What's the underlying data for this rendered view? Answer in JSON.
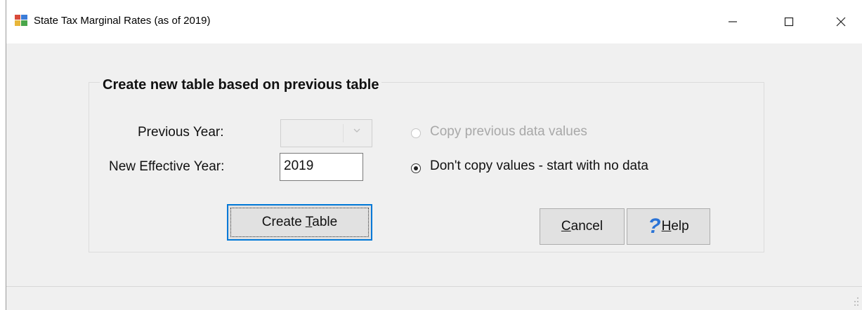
{
  "window": {
    "title": "State Tax Marginal Rates (as of 2019)",
    "icons": {
      "app": "app-icon",
      "minimize": "minimize-icon",
      "maximize": "maximize-icon",
      "close": "close-icon"
    }
  },
  "group": {
    "title": "Create new table based on previous table",
    "previous_year_label": "Previous Year:",
    "previous_year_value": "",
    "new_year_label": "New Effective Year:",
    "new_year_value": "2019",
    "options": [
      {
        "label": "Copy previous data values",
        "selected": false,
        "enabled": false
      },
      {
        "label": "Don't copy values - start with no data",
        "selected": true,
        "enabled": true
      }
    ]
  },
  "buttons": {
    "create_pre": "Create ",
    "create_mnemonic": "T",
    "create_post": "able",
    "cancel_mnemonic": "C",
    "cancel_post": "ancel",
    "help_mnemonic": "H",
    "help_post": "elp",
    "help_glyph": "?"
  },
  "colors": {
    "accent": "#0078d7",
    "window_bg": "#f0f0f0",
    "help_icon": "#2a73d6"
  }
}
